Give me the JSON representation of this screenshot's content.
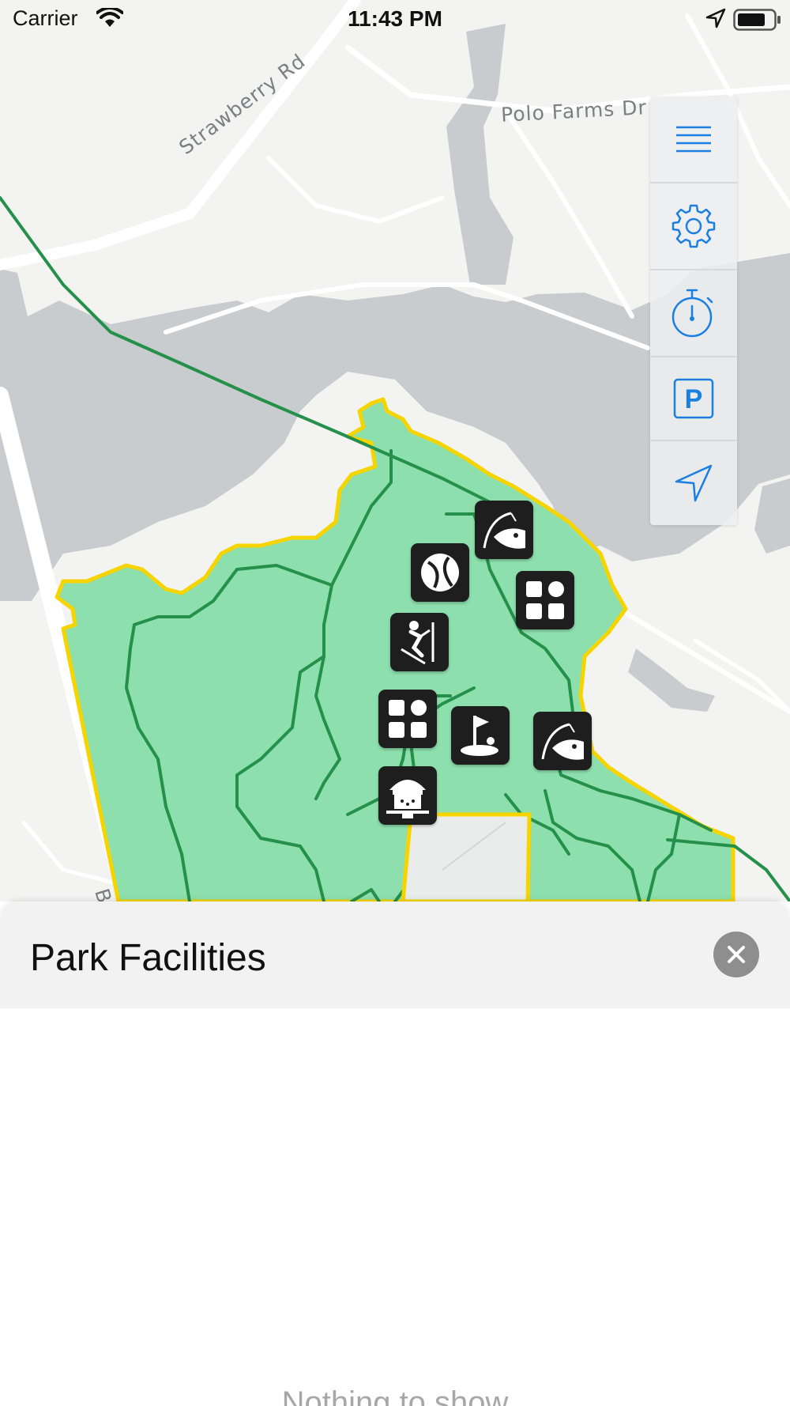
{
  "status_bar": {
    "carrier": "Carrier",
    "time": "11:43 PM"
  },
  "map": {
    "road_labels": {
      "strawberry": "Strawberry Rd",
      "polo_farms": "Polo Farms Dr",
      "bat": "Bat"
    },
    "colors": {
      "park_fill": "#8ddfad",
      "park_boundary": "#f6d400",
      "trail": "#25904a",
      "water": "#c8cccf",
      "land": "#f3f3f2"
    },
    "markers": [
      {
        "type": "fishing",
        "icon": "fishing-icon"
      },
      {
        "type": "tennis",
        "icon": "tennis-ball-icon"
      },
      {
        "type": "facilities",
        "icon": "grid-icon"
      },
      {
        "type": "skiing",
        "icon": "skier-icon"
      },
      {
        "type": "facilities",
        "icon": "grid-icon"
      },
      {
        "type": "golf",
        "icon": "golf-flag-icon"
      },
      {
        "type": "fishing",
        "icon": "fishing-icon"
      },
      {
        "type": "shelter",
        "icon": "gazebo-icon"
      }
    ]
  },
  "toolbar": {
    "accent_color": "#1a7fe0",
    "buttons": [
      "menu-icon",
      "gear-icon",
      "stopwatch-icon",
      "parking-icon",
      "location-arrow-icon"
    ],
    "parking_letter": "P"
  },
  "sheet": {
    "title": "Park Facilities",
    "empty_text": "Nothing to show"
  }
}
